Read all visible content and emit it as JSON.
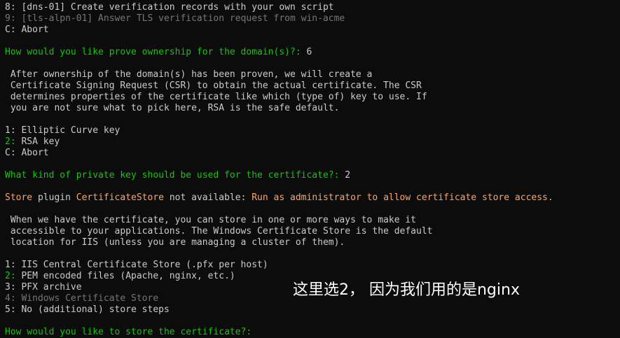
{
  "terminal": {
    "lines": [
      {
        "segments": [
          {
            "text": "8: [dns-01] Create verification records with your own script",
            "color": "#cccccc"
          }
        ]
      },
      {
        "segments": [
          {
            "text": "9: [tls-alpn-01] Answer TLS verification request from win-acme",
            "color": "#767676"
          }
        ]
      },
      {
        "segments": [
          {
            "text": "C: Abort",
            "color": "#cccccc"
          }
        ]
      },
      {
        "segments": []
      },
      {
        "segments": [
          {
            "text": "How would you like prove ownership for the domain(s)?: ",
            "color": "#16c60c"
          },
          {
            "text": "6",
            "color": "#cccccc"
          }
        ]
      },
      {
        "segments": []
      },
      {
        "segments": [
          {
            "text": " After ownership of the domain(s) has been proven, we will create a",
            "color": "#cccccc"
          }
        ]
      },
      {
        "segments": [
          {
            "text": " Certificate Signing Request (CSR) to obtain the actual certificate. The CSR",
            "color": "#cccccc"
          }
        ]
      },
      {
        "segments": [
          {
            "text": " determines properties of the certificate like which (type of) key to use. If",
            "color": "#cccccc"
          }
        ]
      },
      {
        "segments": [
          {
            "text": " you are not sure what to pick here, RSA is the safe default.",
            "color": "#cccccc"
          }
        ]
      },
      {
        "segments": []
      },
      {
        "segments": [
          {
            "text": "1: Elliptic Curve key",
            "color": "#cccccc"
          }
        ]
      },
      {
        "segments": [
          {
            "text": "2: ",
            "color": "#16c60c"
          },
          {
            "text": "RSA key",
            "color": "#cccccc"
          }
        ]
      },
      {
        "segments": [
          {
            "text": "C: Abort",
            "color": "#cccccc"
          }
        ]
      },
      {
        "segments": []
      },
      {
        "segments": [
          {
            "text": "What kind of private key should be used for the certificate?: ",
            "color": "#16c60c"
          },
          {
            "text": "2",
            "color": "#cccccc"
          }
        ]
      },
      {
        "segments": []
      },
      {
        "segments": [
          {
            "text": "Store ",
            "color": "#f9a76b"
          },
          {
            "text": "plugin ",
            "color": "#cccccc"
          },
          {
            "text": "CertificateStore",
            "color": "#f9a76b"
          },
          {
            "text": " not available: ",
            "color": "#cccccc"
          },
          {
            "text": "Run as administrator to allow certificate store access.",
            "color": "#f9a76b"
          }
        ]
      },
      {
        "segments": []
      },
      {
        "segments": [
          {
            "text": " When we have the certificate, you can store in one or more ways to make it",
            "color": "#cccccc"
          }
        ]
      },
      {
        "segments": [
          {
            "text": " accessible to your applications. The Windows Certificate Store is the default",
            "color": "#cccccc"
          }
        ]
      },
      {
        "segments": [
          {
            "text": " location for IIS (unless you are managing a cluster of them).",
            "color": "#cccccc"
          }
        ]
      },
      {
        "segments": []
      },
      {
        "segments": [
          {
            "text": "1: IIS Central Certificate Store (.pfx per host)",
            "color": "#cccccc"
          }
        ]
      },
      {
        "segments": [
          {
            "text": "2: ",
            "color": "#16c60c"
          },
          {
            "text": "PEM encoded files (Apache, nginx, etc.)",
            "color": "#cccccc"
          }
        ]
      },
      {
        "segments": [
          {
            "text": "3: PFX archive",
            "color": "#cccccc"
          }
        ]
      },
      {
        "segments": [
          {
            "text": "4: Windows Certificate Store",
            "color": "#767676"
          }
        ]
      },
      {
        "segments": [
          {
            "text": "5: No (additional) store steps",
            "color": "#cccccc"
          }
        ]
      },
      {
        "segments": []
      },
      {
        "segments": [
          {
            "text": "How would you like to store the certificate?: ",
            "color": "#16c60c"
          }
        ]
      }
    ]
  },
  "overlay": {
    "annotation": "这里选2， 因为我们用的是nginx"
  }
}
